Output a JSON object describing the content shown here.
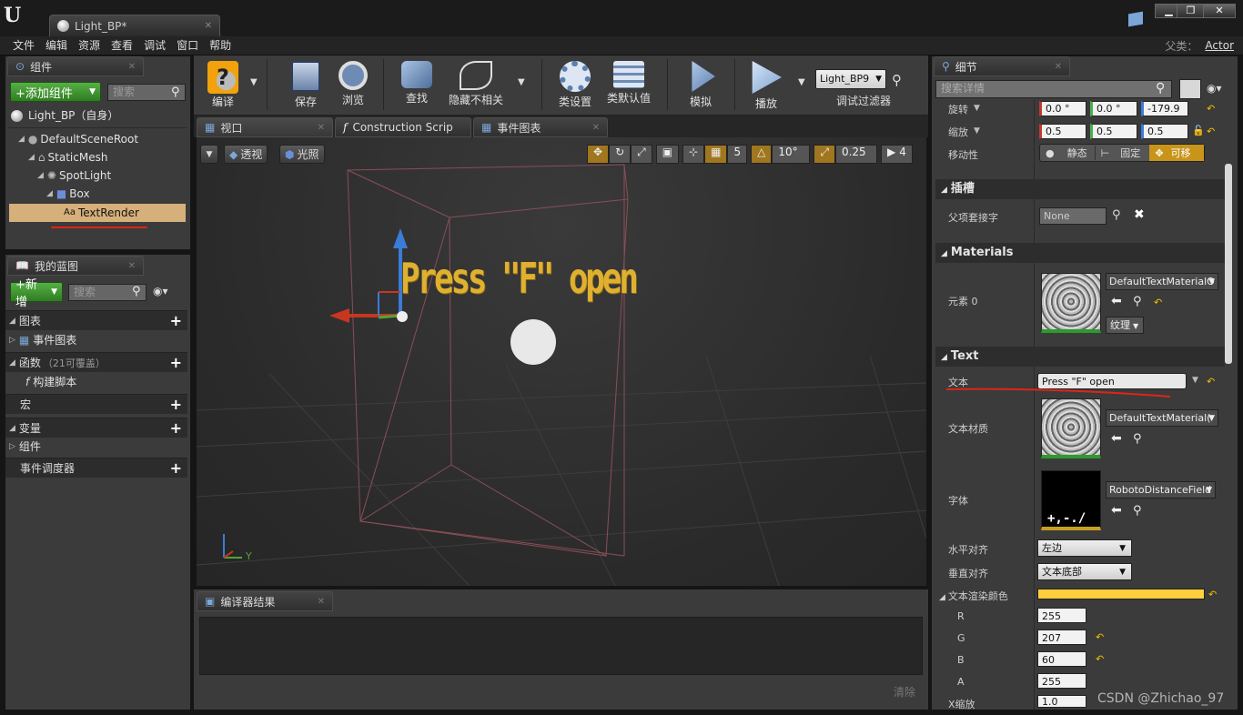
{
  "title_bar": {
    "tab_title": "Light_BP*",
    "parent_class_label": "父类：",
    "parent_class_value": "Actor"
  },
  "window_controls": {
    "minimize": "▁",
    "maximize": "❐",
    "close": "✕"
  },
  "menu": [
    "文件",
    "编辑",
    "资源",
    "查看",
    "调试",
    "窗口",
    "帮助"
  ],
  "components_panel": {
    "tab": "组件",
    "add_button": "+添加组件",
    "search_placeholder": "搜索",
    "self_item": "Light_BP（自身）",
    "tree": [
      "DefaultSceneRoot",
      "StaticMesh",
      "SpotLight",
      "Box",
      "TextRender"
    ]
  },
  "blueprint_panel": {
    "tab": "我的蓝图",
    "add_button": "+新增",
    "search_placeholder": "搜索",
    "sections": [
      {
        "label": "图表",
        "plus": true
      },
      {
        "label": "事件图表",
        "indent": true
      },
      {
        "label": "函数",
        "suffix": "（21可覆盖）",
        "plus": true
      },
      {
        "label": "构建脚本",
        "indent": true
      },
      {
        "label": "宏",
        "plus": true
      },
      {
        "label": "变量",
        "plus": true
      },
      {
        "label": "组件",
        "indent": false
      },
      {
        "label": "事件调度器",
        "plus": true
      }
    ]
  },
  "toolbar": {
    "compile": "编译",
    "save": "保存",
    "browse": "浏览",
    "find": "查找",
    "hide_unrelated": "隐藏不相关",
    "class_settings": "类设置",
    "class_defaults": "类默认值",
    "simulate": "模拟",
    "play": "播放",
    "debug_filter_value": "Light_BP9",
    "debug_filter_label": "调试过滤器"
  },
  "editor_tabs": {
    "viewport": "视口",
    "construction": "Construction Scrip",
    "event_graph": "事件图表"
  },
  "viewport": {
    "perspective": "透视",
    "lit": "光照",
    "grid_snap": "5",
    "rot_snap": "10°",
    "scale_snap": "0.25",
    "cam_speed": "4",
    "scene_text": "Press \"F\" open",
    "axis_y": "Y"
  },
  "compiler": {
    "tab": "编译器结果",
    "clear": "清除"
  },
  "details": {
    "tab": "细节",
    "search_placeholder": "搜索详情",
    "rotation_label": "旋转",
    "rotation": [
      "0.0 °",
      "0.0 °",
      "-179.9"
    ],
    "scale_label": "缩放",
    "scale": [
      "0.5",
      "0.5",
      "0.5"
    ],
    "mobility_label": "移动性",
    "mobility": [
      "静态",
      "固定",
      "可移"
    ],
    "socket_section": "插槽",
    "parent_socket_label": "父项套接字",
    "parent_socket_value": "None",
    "materials_section": "Materials",
    "element0_label": "元素 0",
    "element0_value": "DefaultTextMaterialO",
    "texture_btn": "纹理",
    "text_section": "Text",
    "text_label": "文本",
    "text_value": "Press \"F\" open",
    "text_material_label": "文本材质",
    "text_material_value": "DefaultTextMaterial(",
    "font_label": "字体",
    "font_value": "RobotoDistanceField",
    "h_align_label": "水平对齐",
    "h_align_value": "左边",
    "v_align_label": "垂直对齐",
    "v_align_value": "文本底部",
    "color_label": "文本渲染颜色",
    "color_hex": "#ffcf3c",
    "r_label": "R",
    "r": "255",
    "g_label": "G",
    "g": "207",
    "b_label": "B",
    "b": "60",
    "a_label": "A",
    "a": "255",
    "xscale_label": "X缩放",
    "xscale": "1.0"
  },
  "watermark": "CSDN @Zhichao_97"
}
